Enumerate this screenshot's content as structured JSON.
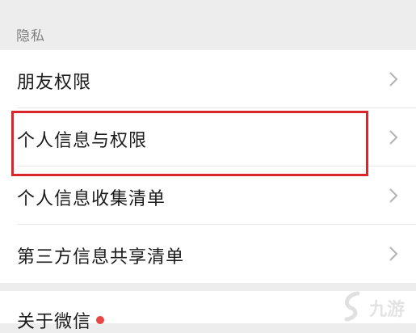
{
  "section": {
    "title": "隐私"
  },
  "rows": [
    {
      "label": "朋友权限"
    },
    {
      "label": "个人信息与权限"
    },
    {
      "label": "个人信息收集清单"
    },
    {
      "label": "第三方信息共享清单"
    }
  ],
  "bottom": {
    "label": "关于微信"
  },
  "watermark": {
    "text": "九游"
  },
  "colors": {
    "highlight": "#d9262b",
    "badge": "#e84545",
    "background": "#ededed",
    "list": "#ffffff"
  },
  "icons": {
    "chevron": "chevron-right-icon",
    "badge": "red-dot-badge",
    "watermark": "jiuyou-logo"
  }
}
